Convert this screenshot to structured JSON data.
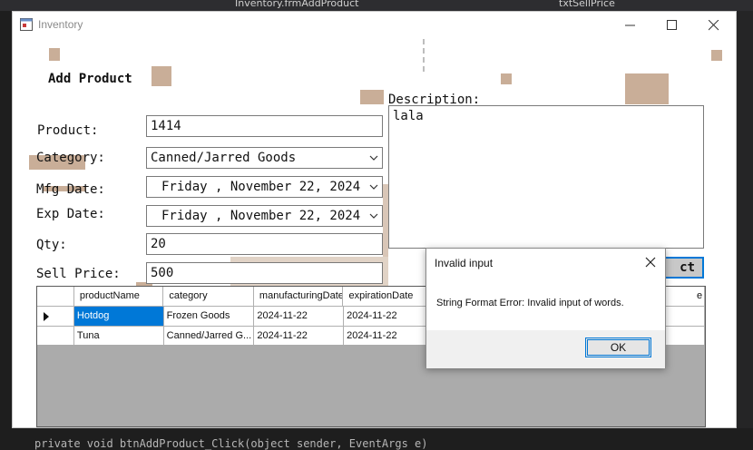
{
  "ide": {
    "tab_left": "Inventory.frmAddProduct",
    "tab_right": "txtSellPrice",
    "code_line": "private void btnAddProduct_Click(object sender, EventArgs e)"
  },
  "window": {
    "title": "Inventory"
  },
  "form": {
    "header": "Add Product",
    "product_label": "Product:",
    "product_value": "1414",
    "category_label": "Category:",
    "category_value": "Canned/Jarred Goods",
    "mfg_label": "Mfg Date:",
    "mfg_value": "Friday  , November  22, 2024",
    "exp_label": "Exp Date:",
    "exp_value": "Friday  , November  22, 2024",
    "qty_label": "Qty:",
    "qty_value": "20",
    "price_label": "Sell Price:",
    "price_value": "500",
    "description_label": "Description:",
    "description_value": "lala",
    "add_button_visible": "ct"
  },
  "grid": {
    "columns": [
      "productName",
      "category",
      "manufacturingDate",
      "expirationDate",
      "e"
    ],
    "rows": [
      [
        "Hotdog",
        "Frozen Goods",
        "2024-11-22",
        "2024-11-22"
      ],
      [
        "Tuna",
        "Canned/Jarred G...",
        "2024-11-22",
        "2024-11-22"
      ]
    ]
  },
  "dialog": {
    "title": "Invalid input",
    "message": "String Format Error: Invalid input of words.",
    "ok_label": "OK"
  }
}
